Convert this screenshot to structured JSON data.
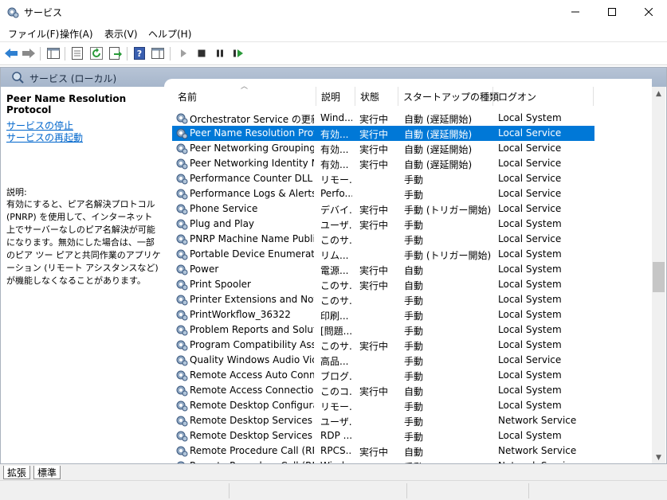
{
  "window": {
    "title": "サービス"
  },
  "menu": [
    "ファイル(F)",
    "操作(A)",
    "表示(V)",
    "ヘルプ(H)"
  ],
  "toolbar": {
    "buttons": [
      "back-icon",
      "forward-icon",
      "show-hide-tree-icon",
      "properties-icon",
      "refresh-icon",
      "export-list-icon",
      "help-icon",
      "action-pane-icon",
      "start-service-icon",
      "stop-service-icon",
      "pause-service-icon",
      "restart-service-icon"
    ]
  },
  "panel": {
    "title": "サービス (ローカル)"
  },
  "left": {
    "service_name": "Peer Name Resolution Protocol",
    "stop_link": "サービスの停止",
    "restart_link": "サービスの再起動",
    "desc_heading": "説明:",
    "description": "有効にすると、ピア名解決プロトコル (PNRP) を使用して、インターネット上でサーバーなしのピア名解決が可能になります。無効にした場合は、一部のピア ツー ピアと共同作業のアプリケーション (リモート アシスタンスなど) が機能しなくなることがあります。"
  },
  "columns": {
    "name": "名前",
    "desc": "説明",
    "status": "状態",
    "startup": "スタートアップの種類",
    "logon": "ログオン"
  },
  "rows": [
    {
      "name": "Orchestrator Service の更新",
      "desc": "Wind...",
      "status": "実行中",
      "startup": "自動 (遅延開始)",
      "logon": "Local System"
    },
    {
      "name": "Peer Name Resolution Prot...",
      "desc": "有効...",
      "status": "実行中",
      "startup": "自動 (遅延開始)",
      "logon": "Local Service",
      "selected": true
    },
    {
      "name": "Peer Networking Grouping",
      "desc": "有効...",
      "status": "実行中",
      "startup": "自動 (遅延開始)",
      "logon": "Local Service"
    },
    {
      "name": "Peer Networking Identity M...",
      "desc": "有効...",
      "status": "実行中",
      "startup": "自動 (遅延開始)",
      "logon": "Local Service"
    },
    {
      "name": "Performance Counter DLL H...",
      "desc": "リモー...",
      "status": "",
      "startup": "手動",
      "logon": "Local Service"
    },
    {
      "name": "Performance Logs & Alerts",
      "desc": "Perfo...",
      "status": "",
      "startup": "手動",
      "logon": "Local Service"
    },
    {
      "name": "Phone Service",
      "desc": "デバイ...",
      "status": "実行中",
      "startup": "手動 (トリガー開始)",
      "logon": "Local Service"
    },
    {
      "name": "Plug and Play",
      "desc": "ユーザ...",
      "status": "実行中",
      "startup": "手動",
      "logon": "Local System"
    },
    {
      "name": "PNRP Machine Name Publi...",
      "desc": "このサ...",
      "status": "",
      "startup": "手動",
      "logon": "Local Service"
    },
    {
      "name": "Portable Device Enumerator...",
      "desc": "リム...",
      "status": "",
      "startup": "手動 (トリガー開始)",
      "logon": "Local System"
    },
    {
      "name": "Power",
      "desc": "電源...",
      "status": "実行中",
      "startup": "自動",
      "logon": "Local System"
    },
    {
      "name": "Print Spooler",
      "desc": "このサ...",
      "status": "実行中",
      "startup": "自動",
      "logon": "Local System"
    },
    {
      "name": "Printer Extensions and Notif...",
      "desc": "このサ...",
      "status": "",
      "startup": "手動",
      "logon": "Local System"
    },
    {
      "name": "PrintWorkflow_36322",
      "desc": "印刷...",
      "status": "",
      "startup": "手動",
      "logon": "Local System"
    },
    {
      "name": "Problem Reports and Soluti...",
      "desc": "[問題...",
      "status": "",
      "startup": "手動",
      "logon": "Local System"
    },
    {
      "name": "Program Compatibility Assis...",
      "desc": "このサ...",
      "status": "実行中",
      "startup": "手動",
      "logon": "Local System"
    },
    {
      "name": "Quality Windows Audio Vid...",
      "desc": "高品...",
      "status": "",
      "startup": "手動",
      "logon": "Local Service"
    },
    {
      "name": "Remote Access Auto Conne...",
      "desc": "ブログ...",
      "status": "",
      "startup": "手動",
      "logon": "Local System"
    },
    {
      "name": "Remote Access Connection ...",
      "desc": "このコ...",
      "status": "実行中",
      "startup": "自動",
      "logon": "Local System"
    },
    {
      "name": "Remote Desktop Configurat...",
      "desc": "リモー...",
      "status": "",
      "startup": "手動",
      "logon": "Local System"
    },
    {
      "name": "Remote Desktop Services",
      "desc": "ユーザ...",
      "status": "",
      "startup": "手動",
      "logon": "Network Service"
    },
    {
      "name": "Remote Desktop Services Us...",
      "desc": "RDP ...",
      "status": "",
      "startup": "手動",
      "logon": "Local System"
    },
    {
      "name": "Remote Procedure Call (RPC)",
      "desc": "RPCS...",
      "status": "実行中",
      "startup": "自動",
      "logon": "Network Service"
    },
    {
      "name": "Remote Procedure Call (RPC...",
      "desc": "Wind...",
      "status": "",
      "startup": "手動",
      "logon": "Network Service"
    }
  ],
  "tabs": [
    "拡張",
    "標準"
  ],
  "colors": {
    "selection": "#0078d7",
    "link": "#0066cc",
    "panel_header": "#b7c4d6"
  }
}
